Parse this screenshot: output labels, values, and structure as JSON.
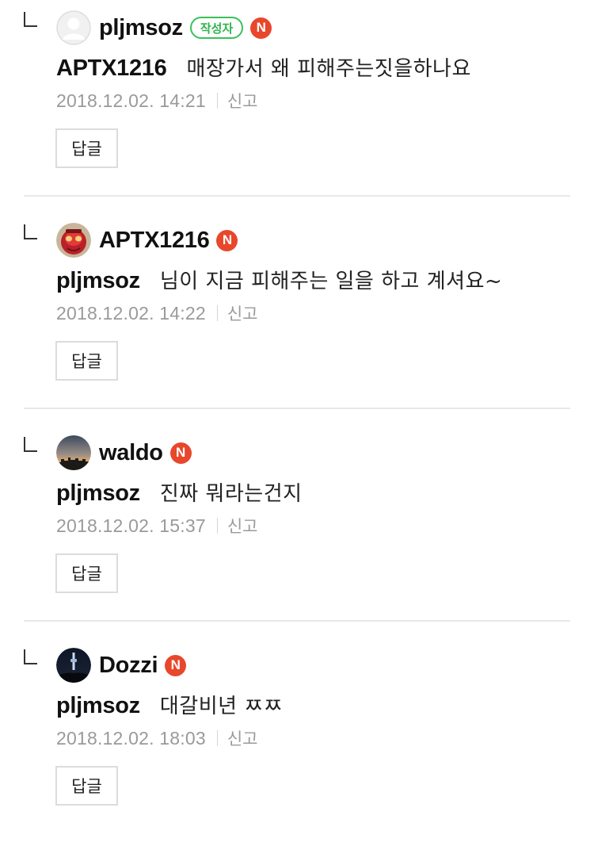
{
  "comments": [
    {
      "author": "pljmsoz",
      "writer_badge": "작성자",
      "new_badge": "N",
      "mention": "APTX1216",
      "text": "매장가서 왜 피해주는짓을하나요",
      "date": "2018.12.02. 14:21",
      "report": "신고",
      "reply": "답글",
      "avatar": "default-profile"
    },
    {
      "author": "APTX1216",
      "new_badge": "N",
      "mention": "pljmsoz",
      "text": "님이 지금 피해주는 일을 하고 계셔요~",
      "date": "2018.12.02. 14:22",
      "report": "신고",
      "reply": "답글",
      "avatar": "red-character"
    },
    {
      "author": "waldo",
      "new_badge": "N",
      "mention": "pljmsoz",
      "text": "진짜 뭐라는건지",
      "date": "2018.12.02. 15:37",
      "report": "신고",
      "reply": "답글",
      "avatar": "city-skyline"
    },
    {
      "author": "Dozzi",
      "new_badge": "N",
      "mention": "pljmsoz",
      "text": "대갈비년 ㅉㅉ",
      "date": "2018.12.02. 18:03",
      "report": "신고",
      "reply": "답글",
      "avatar": "night-tower"
    }
  ],
  "colors": {
    "writer_badge": "#3bc15a",
    "new_badge": "#e8472c",
    "meta_text": "#9a9a9a"
  }
}
